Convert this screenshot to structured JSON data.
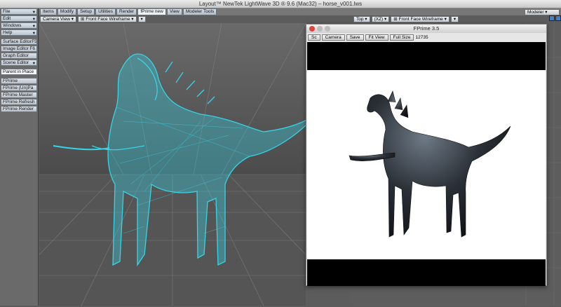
{
  "window": {
    "title": "Layout™ NewTek LightWave 3D ® 9.6  (Mac32) – horse_v001.lws"
  },
  "left_menu": [
    {
      "label": "File",
      "arrow": "▾"
    },
    {
      "label": "Edit",
      "arrow": "▾"
    },
    {
      "label": "Windows",
      "arrow": "▾"
    },
    {
      "label": "Help",
      "arrow": "▾"
    },
    {
      "label": "Surface Editor",
      "hotkey": "F5"
    },
    {
      "label": "Image Editor",
      "hotkey": "F6"
    },
    {
      "label": "Graph Editor",
      "hotkey": ""
    },
    {
      "label": "Scene Editor",
      "arrow": "▾"
    },
    {
      "label": "Parent in Place",
      "white": true
    },
    {
      "label": "FPrime"
    },
    {
      "label": "FPrime (Un)Pa"
    },
    {
      "label": "FPrime Master"
    },
    {
      "label": "FPrime Refresh"
    },
    {
      "label": "FPrime Render"
    }
  ],
  "tabs": [
    "Items",
    "Modify",
    "Setup",
    "Utilities",
    "Render",
    "fPrime new",
    "View",
    "Modeler Tools"
  ],
  "active_tab": "fPrime new",
  "viewport1": {
    "view": "Camera View",
    "mode": "Front Face Wireframe"
  },
  "viewport2": {
    "view": "Top",
    "axis": "(XZ)",
    "mode": "Front Face Wireframe"
  },
  "modeler_btn": "Modeler",
  "fprime": {
    "title": "FPrime 3.5",
    "buttons": [
      "Sc",
      "Camera",
      "Save",
      "Fit View",
      "Full Size"
    ],
    "count": "12735"
  },
  "colors": {
    "wire": "#34d6e8",
    "bg": "#5c5c5c"
  }
}
